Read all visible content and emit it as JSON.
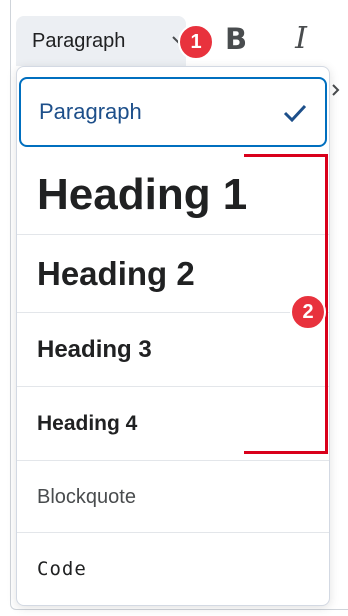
{
  "toolbar": {
    "format_value": "Paragraph",
    "bold_label": "B",
    "italic_label": "I",
    "chevron_icon": "chevron-down-icon"
  },
  "badges": {
    "one": "1",
    "two": "2"
  },
  "dropdown": {
    "items": [
      {
        "label": "Paragraph",
        "selected": true
      },
      {
        "label": "Heading 1"
      },
      {
        "label": "Heading 2"
      },
      {
        "label": "Heading 3"
      },
      {
        "label": "Heading 4"
      },
      {
        "label": "Blockquote"
      },
      {
        "label": "Code"
      }
    ]
  },
  "colors": {
    "accent": "#006fbf",
    "annotation_red": "#d9001b",
    "badge_red": "#e8323d"
  }
}
